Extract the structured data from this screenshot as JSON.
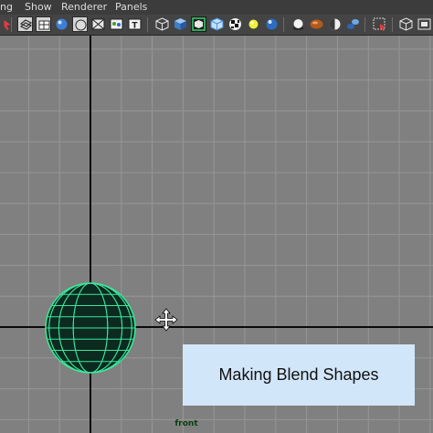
{
  "menubar": {
    "items": [
      "ng",
      "Show",
      "Renderer",
      "Panels"
    ]
  },
  "toolbar": {
    "icons": [
      "select-camera-icon",
      "camera-attributes-icon",
      "bookmarks-icon",
      "image-plane-icon",
      "grid-icon",
      "film-gate-icon",
      "resolution-gate-icon",
      "field-chart-icon",
      "wireframe-cube-icon",
      "smooth-shade-cube-icon",
      "isolate-select-icon",
      "xray-cube-icon",
      "textured-checker-icon",
      "default-lighting-icon",
      "all-lights-icon",
      "shadows-icon",
      "screen-space-ao-icon",
      "motion-blur-icon",
      "anti-aliasing-icon",
      "grease-pencil-icon",
      "resolution-icon"
    ]
  },
  "viewport": {
    "view_name": "front",
    "grid_color": "#969696",
    "axis_color": "#0a0a0a",
    "object_color": "#39e89b",
    "object_name": "sphere-wireframe"
  },
  "caption": {
    "text": "Making Blend Shapes"
  }
}
